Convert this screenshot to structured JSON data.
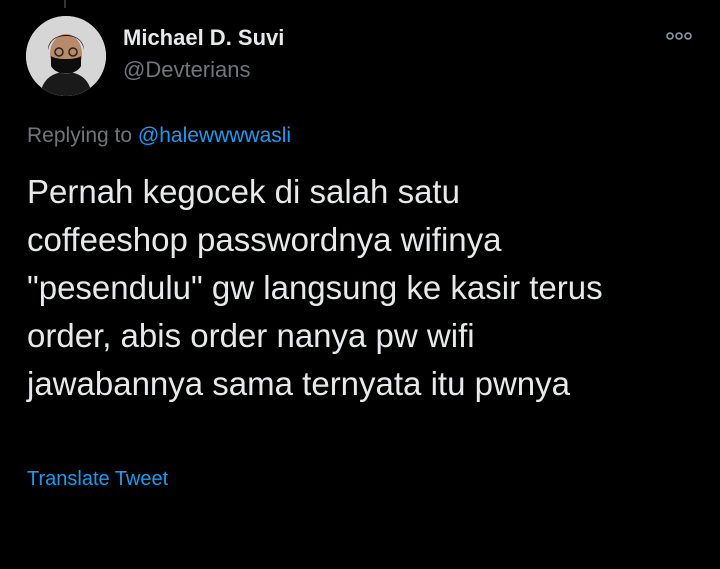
{
  "tweet": {
    "author": {
      "display_name": "Michael D. Suvi",
      "handle": "@Devterians"
    },
    "replying_prefix": "Replying to",
    "replying_to": "@halewwwwasli",
    "text": "Pernah kegocek di salah satu\ncoffeeshop passwordnya wifinya\n\"pesendulu\" gw langsung ke kasir terus\norder, abis order nanya pw wifi\njawabannya sama ternyata itu pwnya",
    "translate_label": "Translate Tweet",
    "more_icon": "more-options-icon"
  },
  "colors": {
    "background": "#000000",
    "primary_text": "#e7e9ea",
    "secondary_text": "#71767b",
    "accent": "#1d9bf0"
  }
}
